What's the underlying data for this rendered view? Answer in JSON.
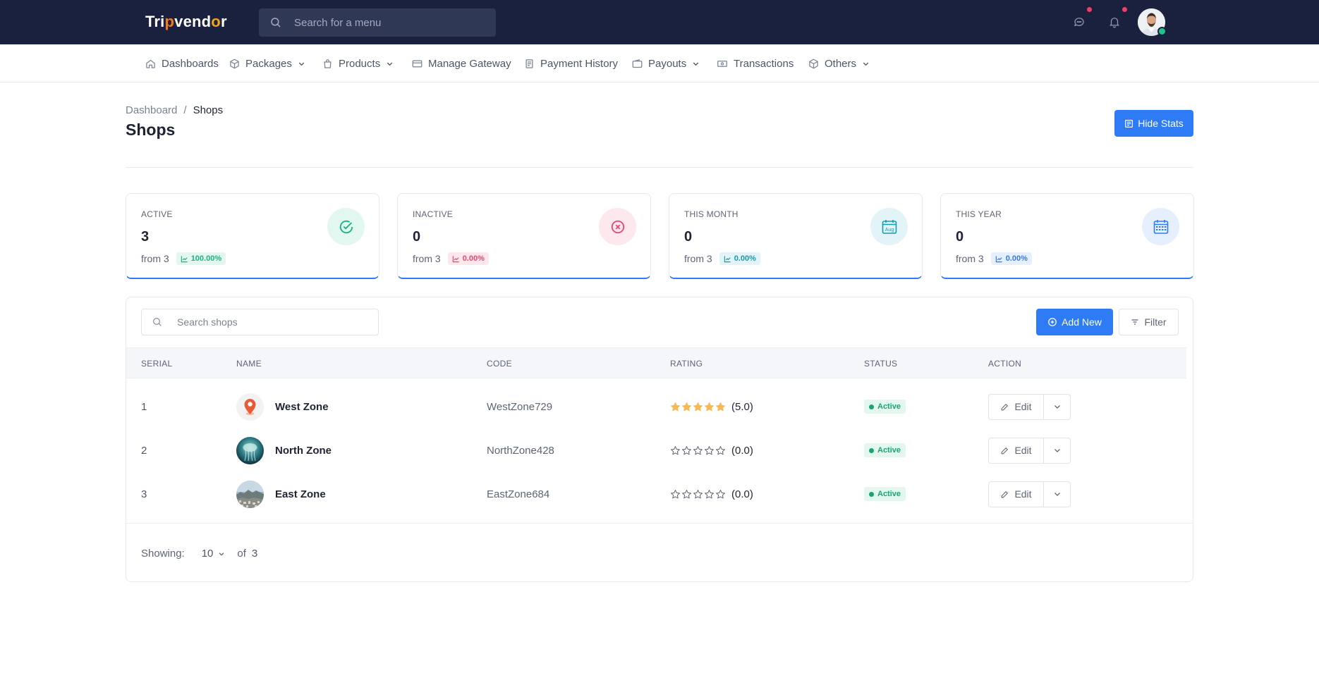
{
  "brand": {
    "logo_prefix": "Tri",
    "logo_pin": "p",
    "logo_mid": "vend",
    "logo_o": "o",
    "logo_suffix": "r"
  },
  "topbar": {
    "search_placeholder": "Search for a menu",
    "icons": [
      "search-icon",
      "chat-icon",
      "bell-icon",
      "user-avatar"
    ],
    "notification_dot_color": "#f03e6b",
    "online_color": "#22c08b"
  },
  "nav": {
    "items": [
      {
        "label": "Dashboards",
        "icon": "home-icon",
        "dropdown": false
      },
      {
        "label": "Packages",
        "icon": "box-icon",
        "dropdown": true
      },
      {
        "label": "Products",
        "icon": "bag-icon",
        "dropdown": true
      },
      {
        "label": "Manage Gateway",
        "icon": "card-icon",
        "dropdown": false
      },
      {
        "label": "Payment History",
        "icon": "receipt-icon",
        "dropdown": false
      },
      {
        "label": "Payouts",
        "icon": "wallet-icon",
        "dropdown": true
      },
      {
        "label": "Transactions",
        "icon": "cash-icon",
        "dropdown": false
      },
      {
        "label": "Others",
        "icon": "cube-icon",
        "dropdown": true
      }
    ]
  },
  "breadcrumb": {
    "root": "Dashboard",
    "separator": "/",
    "current": "Shops"
  },
  "page": {
    "title": "Shops",
    "hide_stats_label": "Hide Stats",
    "accent_color": "#2f7bf5"
  },
  "stats": [
    {
      "label": "ACTIVE",
      "value": "3",
      "from": "from 3",
      "change": "100.00%",
      "icon": "check-circle-icon",
      "color": "#18b386"
    },
    {
      "label": "INACTIVE",
      "value": "0",
      "from": "from 3",
      "change": "0.00%",
      "icon": "x-circle-icon",
      "color": "#e8486f"
    },
    {
      "label": "THIS MONTH",
      "value": "0",
      "from": "from 3",
      "change": "0.00%",
      "icon": "calendar-month-icon",
      "icon_text": "Aug",
      "color": "#149bb0"
    },
    {
      "label": "THIS YEAR",
      "value": "0",
      "from": "from 3",
      "change": "0.00%",
      "icon": "calendar-year-icon",
      "color": "#2f7bf5"
    }
  ],
  "table": {
    "search_placeholder": "Search shops",
    "add_new_label": "Add New",
    "filter_label": "Filter",
    "columns": [
      "SERIAL",
      "NAME",
      "CODE",
      "RATING",
      "STATUS",
      "ACTION"
    ],
    "rows": [
      {
        "serial": "1",
        "name": "West Zone",
        "code": "WestZone729",
        "rating": 5,
        "rating_text": "(5.0)",
        "status": "Active",
        "avatar": "map-pin-avatar",
        "edit_label": "Edit"
      },
      {
        "serial": "2",
        "name": "North Zone",
        "code": "NorthZone428",
        "rating": 0,
        "rating_text": "(0.0)",
        "status": "Active",
        "avatar": "jellyfish-photo-avatar",
        "edit_label": "Edit"
      },
      {
        "serial": "3",
        "name": "East Zone",
        "code": "EastZone684",
        "rating": 0,
        "rating_text": "(0.0)",
        "status": "Active",
        "avatar": "city-photo-avatar",
        "edit_label": "Edit"
      }
    ],
    "star_filled_color": "#f7b955",
    "status_color": "#18a473"
  },
  "pagination": {
    "showing_label": "Showing:",
    "per_page": "10",
    "of_label": "of",
    "total": "3"
  }
}
